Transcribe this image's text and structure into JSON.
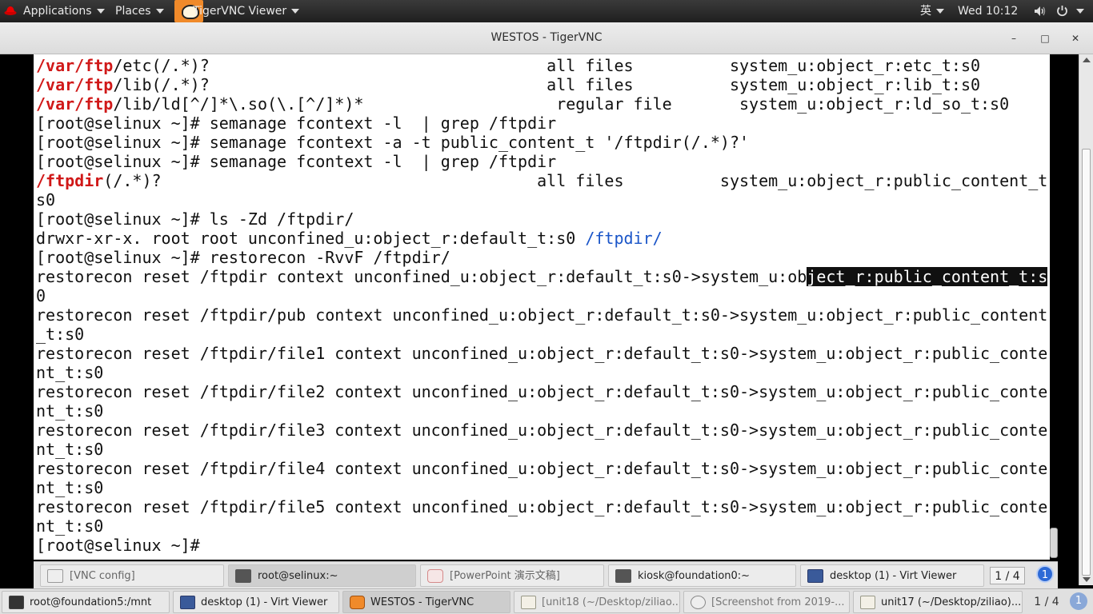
{
  "topbar": {
    "applications": "Applications",
    "places": "Places",
    "app_name": "TigerVNC Viewer",
    "input_method": "英",
    "clock": "Wed 10:12",
    "icons": [
      "redhat-icon",
      "volume-icon",
      "power-icon"
    ]
  },
  "window": {
    "title": "WESTOS - TigerVNC",
    "minimize": "–",
    "maximize": "□",
    "close": "✕"
  },
  "terminal": {
    "lines": [
      {
        "a": "/var/ftp",
        "b": "/etc(/.*)?                                   all files          system_u:object_r:etc_t:s0"
      },
      {
        "a": "/var/ftp",
        "b": "/lib(/.*)?                                   all files          system_u:object_r:lib_t:s0"
      },
      {
        "a": "/var/ftp",
        "b": "/lib/ld[^/]*\\.so(\\.[^/]*)*                    regular file       system_u:object_r:ld_so_t:s0"
      },
      {
        "t": "[root@selinux ~]# semanage fcontext -l  | grep /ftpdir"
      },
      {
        "t": "[root@selinux ~]# semanage fcontext -a -t public_content_t '/ftpdir(/.*)?'"
      },
      {
        "t": "[root@selinux ~]# semanage fcontext -l  | grep /ftpdir"
      },
      {
        "a": "/ftpdir",
        "b": "(/.*)?                                       all files          system_u:object_r:public_content_t:"
      },
      {
        "t": "s0"
      },
      {
        "t": "[root@selinux ~]# ls -Zd /ftpdir/"
      },
      {
        "b": "drwxr-xr-x. root root unconfined_u:object_r:default_t:s0 ",
        "c": "/ftpdir/"
      },
      {
        "t": "[root@selinux ~]# restorecon -RvvF /ftpdir/"
      },
      {
        "b": "restorecon reset /ftpdir context unconfined_u:object_r:default_t:s0->system_u:ob",
        "s": "ject_r:public_content_t:s"
      },
      {
        "t": "0"
      },
      {
        "t": "restorecon reset /ftpdir/pub context unconfined_u:object_r:default_t:s0->system_u:object_r:public_content"
      },
      {
        "t": "_t:s0"
      },
      {
        "t": "restorecon reset /ftpdir/file1 context unconfined_u:object_r:default_t:s0->system_u:object_r:public_conte"
      },
      {
        "t": "nt_t:s0"
      },
      {
        "t": "restorecon reset /ftpdir/file2 context unconfined_u:object_r:default_t:s0->system_u:object_r:public_conte"
      },
      {
        "t": "nt_t:s0"
      },
      {
        "t": "restorecon reset /ftpdir/file3 context unconfined_u:object_r:default_t:s0->system_u:object_r:public_conte"
      },
      {
        "t": "nt_t:s0"
      },
      {
        "t": "restorecon reset /ftpdir/file4 context unconfined_u:object_r:default_t:s0->system_u:object_r:public_conte"
      },
      {
        "t": "nt_t:s0"
      },
      {
        "t": "restorecon reset /ftpdir/file5 context unconfined_u:object_r:default_t:s0->system_u:object_r:public_conte"
      },
      {
        "t": "nt_t:s0"
      },
      {
        "t": "[root@selinux ~]#"
      }
    ]
  },
  "inner_taskbar": {
    "items": [
      {
        "label": "[VNC config]",
        "icon": "vnc-config-icon"
      },
      {
        "label": "root@selinux:~",
        "icon": "terminal-icon"
      },
      {
        "label": "[PowerPoint 演示文稿]",
        "icon": "presentation-icon"
      },
      {
        "label": "kiosk@foundation0:~",
        "icon": "terminal-icon"
      },
      {
        "label": "desktop (1) - Virt Viewer",
        "icon": "monitor-icon"
      }
    ],
    "pager": "1 / 4",
    "badge": "1"
  },
  "outer_taskbar": {
    "items": [
      {
        "label": "root@foundation5:/mnt",
        "icon": "terminal-icon"
      },
      {
        "label": "desktop (1) - Virt Viewer",
        "icon": "monitor-icon"
      },
      {
        "label": "WESTOS - TigerVNC",
        "icon": "vnc-icon"
      },
      {
        "label": "[unit18 (~/Desktop/ziliao...",
        "icon": "document-icon"
      },
      {
        "label": "[Screenshot from 2019-...",
        "icon": "screenshot-icon"
      },
      {
        "label": "unit17 (~/Desktop/ziliao)...",
        "icon": "document-icon"
      }
    ],
    "pager": "1 / 4",
    "badge": "1"
  }
}
